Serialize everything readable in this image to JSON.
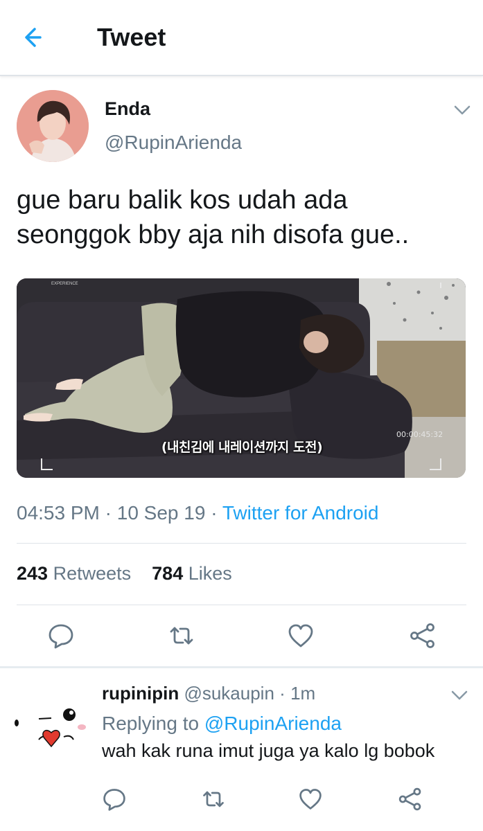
{
  "header": {
    "title": "Tweet",
    "back_icon": "arrow-left-icon",
    "accent": "#1da1f2"
  },
  "tweet": {
    "author_name": "Enda",
    "author_handle": "@RupinArienda",
    "text_line1": "gue baru balik kos udah ada",
    "text_line2": "seonggok bby aja nih disofa gue..",
    "media": {
      "subtitle": "(내친김에 내레이션까지 도전)",
      "timecode": "00:00:45:32",
      "watermark": "EXPERIENCE"
    },
    "time": "04:53 PM",
    "date": "10 Sep 19",
    "separator": "·",
    "source": "Twitter for Android",
    "retweets_count": "243",
    "retweets_label": "Retweets",
    "likes_count": "784",
    "likes_label": "Likes",
    "actions": [
      "reply-icon",
      "retweet-icon",
      "like-icon",
      "share-icon"
    ]
  },
  "reply": {
    "name": "rupinipin",
    "handle": "@sukaupin",
    "separator": "·",
    "time": "1m",
    "replying_prefix": "Replying to",
    "replying_to": "@RupinArienda",
    "text": "wah kak runa imut juga ya kalo lg bobok",
    "actions": [
      "reply-icon",
      "retweet-icon",
      "like-icon",
      "share-icon"
    ]
  }
}
